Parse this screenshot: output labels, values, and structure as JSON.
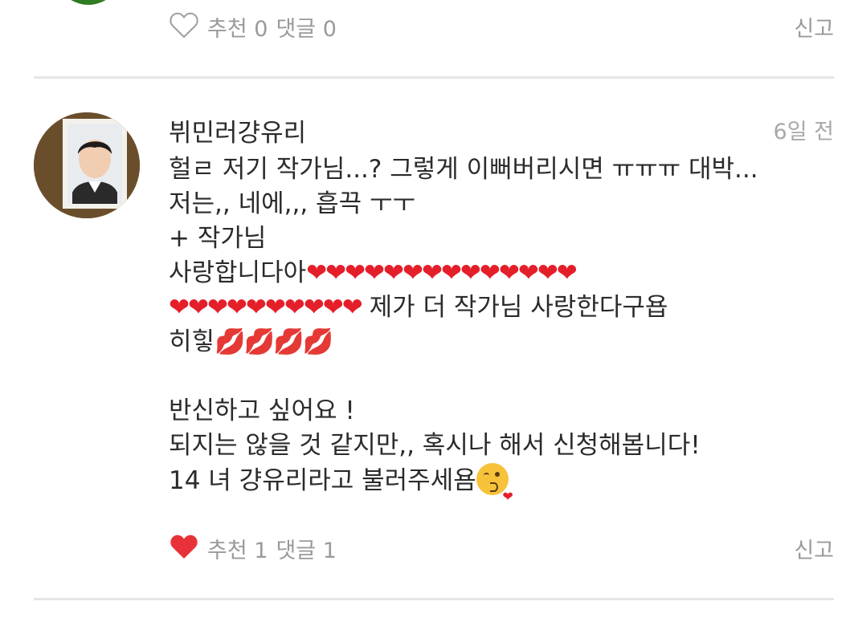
{
  "prev_comment": {
    "like_label": "추천 0",
    "reply_label": "댓글 0",
    "report_label": "신고"
  },
  "comment": {
    "username": "뷔민러걍유리",
    "date": "6일 전",
    "lines": {
      "l1": "헐ㄹ 저기 작가님...? 그렇게 이뻐버리시면 ㅠㅠㅠ 대박...",
      "l2": "저는,, 네에,,, 흡끅 ㅜㅜ",
      "l3": "+ 작가님",
      "l4_text": "사랑합니다아",
      "l4_hearts": "❤❤❤❤❤❤❤❤❤❤❤❤❤❤",
      "l5_hearts": "❤❤❤❤❤❤❤❤❤❤",
      "l5_text": " 제가 더 작가님 사랑한다구욥",
      "l6_text": "히힣",
      "l6_kisses": "💋💋💋💋",
      "l7": "반신하고 싶어요 !",
      "l8": "되지는 않을 것 같지만,, 혹시나 해서 신청해봅니다!",
      "l9": "14 녀 걍유리라고 불러주세욤"
    },
    "like_label": "추천 1",
    "reply_label": "댓글 1",
    "report_label": "신고",
    "liked": true,
    "accent_color": "#e8323a"
  }
}
